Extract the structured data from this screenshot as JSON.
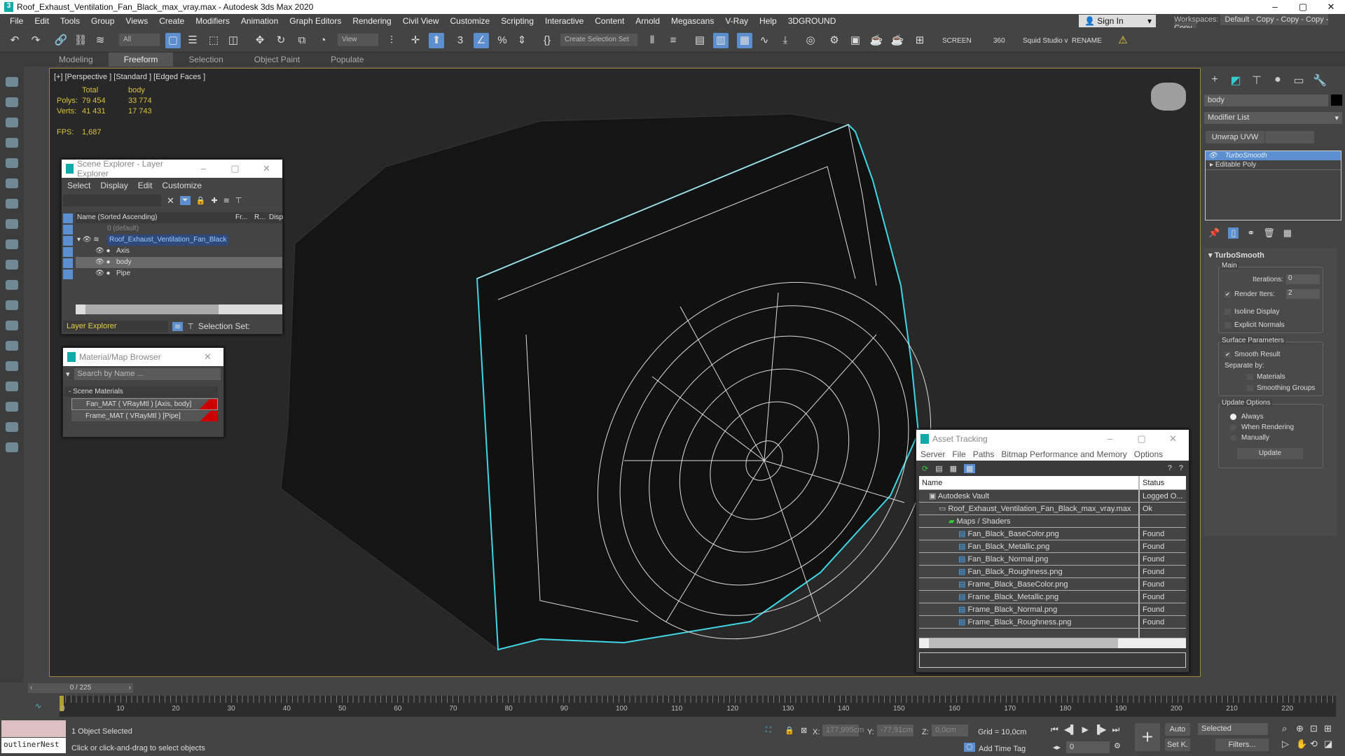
{
  "window": {
    "title": "Roof_Exhaust_Ventilation_Fan_Black_max_vray.max - Autodesk 3ds Max 2020",
    "minimize": "–",
    "maximize": "▢",
    "close": "✕"
  },
  "menu": [
    "File",
    "Edit",
    "Tools",
    "Group",
    "Views",
    "Create",
    "Modifiers",
    "Animation",
    "Graph Editors",
    "Rendering",
    "Civil View",
    "Customize",
    "Scripting",
    "Interactive",
    "Content",
    "Arnold",
    "Megascans",
    "V-Ray",
    "Help",
    "3DGROUND"
  ],
  "signin": "Sign In",
  "workspaces_label": "Workspaces:",
  "workspace": "Default - Copy - Copy - Copy - Copy",
  "toolbar": {
    "filter": "All",
    "refcoord": "View",
    "selset": "Create Selection Set",
    "screen": "SCREEN",
    "n360": "360",
    "squid": "Squid Studio v",
    "rename": "RENAME"
  },
  "ribbon": [
    "Modeling",
    "Freeform",
    "Selection",
    "Object Paint",
    "Populate"
  ],
  "viewport": {
    "label": "[+] [Perspective ] [Standard ] [Edged Faces ]",
    "stats": {
      "h_total": "Total",
      "h_body": "body",
      "polys_label": "Polys:",
      "polys_total": "79 454",
      "polys_body": "33 774",
      "verts_label": "Verts:",
      "verts_total": "41 431",
      "verts_body": "17 743",
      "fps_label": "FPS:",
      "fps": "1,687"
    }
  },
  "scene_explorer": {
    "title": "Scene Explorer - Layer Explorer",
    "menu": [
      "Select",
      "Display",
      "Edit",
      "Customize"
    ],
    "cols": {
      "name": "Name (Sorted Ascending)",
      "fr": "Fr...",
      "r": "R...",
      "disp": "Disp"
    },
    "rows": [
      {
        "name": "0 (default)"
      },
      {
        "name": "Roof_Exhaust_Ventilation_Fan_Black"
      },
      {
        "name": "Axis"
      },
      {
        "name": "body"
      },
      {
        "name": "Pipe"
      }
    ],
    "footer": "Layer Explorer",
    "selset": "Selection Set:"
  },
  "material_browser": {
    "title": "Material/Map Browser",
    "search": "Search by Name ...",
    "group": "- Scene Materials",
    "items": [
      "Fan_MAT  ( VRayMtl )  [Axis, body]",
      "Frame_MAT  ( VRayMtl )  [Pipe]"
    ]
  },
  "asset_tracking": {
    "title": "Asset Tracking",
    "menu": [
      "Server",
      "File",
      "Paths",
      "Bitmap Performance and Memory",
      "Options"
    ],
    "col_name": "Name",
    "col_status": "Status",
    "rows": [
      {
        "name": "Autodesk Vault",
        "status": "Logged O...",
        "lvl": 1
      },
      {
        "name": "Roof_Exhaust_Ventilation_Fan_Black_max_vray.max",
        "status": "Ok",
        "lvl": 2
      },
      {
        "name": "Maps / Shaders",
        "status": "",
        "lvl": 3
      },
      {
        "name": "Fan_Black_BaseColor.png",
        "status": "Found",
        "lvl": 4
      },
      {
        "name": "Fan_Black_Metallic.png",
        "status": "Found",
        "lvl": 4
      },
      {
        "name": "Fan_Black_Normal.png",
        "status": "Found",
        "lvl": 4
      },
      {
        "name": "Fan_Black_Roughness.png",
        "status": "Found",
        "lvl": 4
      },
      {
        "name": "Frame_Black_BaseColor.png",
        "status": "Found",
        "lvl": 4
      },
      {
        "name": "Frame_Black_Metallic.png",
        "status": "Found",
        "lvl": 4
      },
      {
        "name": "Frame_Black_Normal.png",
        "status": "Found",
        "lvl": 4
      },
      {
        "name": "Frame_Black_Roughness.png",
        "status": "Found",
        "lvl": 4
      }
    ]
  },
  "command_panel": {
    "object_name": "body",
    "object_color": "#000000",
    "modifier_list": "Modifier List",
    "unwrap": "Unwrap UVW",
    "stack": [
      "TurboSmooth",
      "Editable Poly"
    ],
    "rollout": "TurboSmooth",
    "main": "Main",
    "iterations_label": "Iterations:",
    "iterations": "0",
    "render_iters_label": "Render Iters:",
    "render_iters": "2",
    "isoline": "Isoline Display",
    "explicit": "Explicit Normals",
    "surface": "Surface Parameters",
    "smooth_result": "Smooth Result",
    "separate": "Separate by:",
    "materials": "Materials",
    "smoothing": "Smoothing Groups",
    "update_opts": "Update Options",
    "always": "Always",
    "when_rendering": "When Rendering",
    "manually": "Manually",
    "update": "Update"
  },
  "timeline": {
    "frame": "0 / 225",
    "ticks": [
      "0",
      "10",
      "20",
      "30",
      "40",
      "50",
      "60",
      "70",
      "80",
      "90",
      "100",
      "110",
      "120",
      "130",
      "140",
      "150",
      "160",
      "170",
      "180",
      "190",
      "200",
      "210",
      "220"
    ]
  },
  "status": {
    "script": "outlinerNest",
    "selected": "1 Object Selected",
    "prompt": "Click or click-and-drag to select objects",
    "x_label": "X:",
    "x": "177,995cm",
    "y_label": "Y:",
    "y": "-77,91cm",
    "z_label": "Z:",
    "z": "0,0cm",
    "grid": "Grid = 10,0cm",
    "timetag": "Add Time Tag",
    "auto": "Auto",
    "setk": "Set K.",
    "selected_dd": "Selected",
    "filters": "Filters...",
    "frame_val": "0"
  },
  "colors": {
    "accent": "#5b8fd0",
    "selection": "#3fd6e6",
    "viewport_border": "#a08a3a",
    "stats": "#d8c23a"
  }
}
